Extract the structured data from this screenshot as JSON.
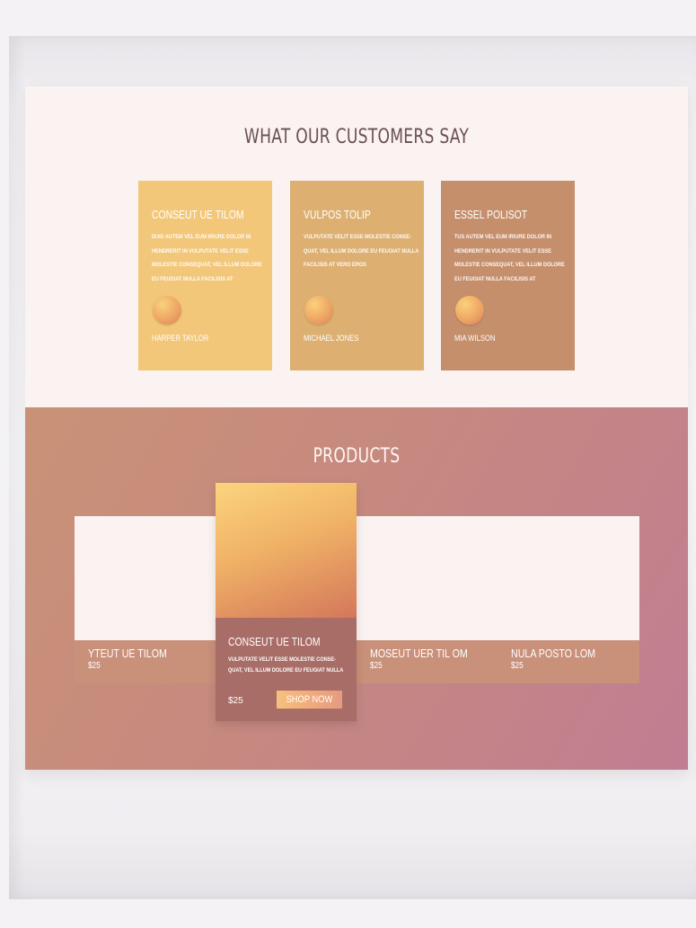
{
  "testimonials": {
    "title": "WHAT OUR CUSTOMERS SAY",
    "cards": [
      {
        "name": "CONSEUT UE TILOM",
        "text": "DUIS AUTEM VEL EUM IRIURE DOLOR IN HENDRERIT IN VULPUTATE VELIT ESSE MOLESTIE CONSEQUAT, VEL ILLUM DOLORE EU FEUGIAT NULLA FACILISIS AT",
        "author": "HARPER TAYLOR",
        "color": "#f2c77a"
      },
      {
        "name": "VULPOS TOLIP",
        "text": "VULPUTATE VELIT ESSE MOLESTIE CONSE- QUAT, VEL ILLUM DOLORE EU FEUGIAT NULLA FACILISIS AT VERO EROS",
        "author": "MICHAEL JONES",
        "color": "#ddb072"
      },
      {
        "name": "ESSEL POLISOT",
        "text": "TUS AUTEM VEL EUM IRIURE DOLOR IN HENDRERIT IN VULPUTATE VELIT ESSE MOLESTIE CONSEQUAT, VEL ILLUM DOLORE EU FEUGIAT NULLA FACILISIS AT",
        "author": "MIA WILSON",
        "color": "#c58f6c"
      }
    ]
  },
  "products": {
    "title": "PRODUCTS",
    "items": [
      {
        "name": "YTEUT UE TILOM",
        "price": "$25"
      },
      {
        "name": "MOSEUT UER TIL OM",
        "price": "$25"
      },
      {
        "name": "NULA POSTO LOM",
        "price": "$25"
      }
    ],
    "featured": {
      "name": "CONSEUT UE TILOM",
      "description": "VULPUTATE VELIT ESSE MOLESTIE CONSE- QUAT, VEL ILLUM DOLORE EU FEUGIAT NULLA",
      "price": "$25",
      "button_label": "SHOP NOW"
    }
  }
}
